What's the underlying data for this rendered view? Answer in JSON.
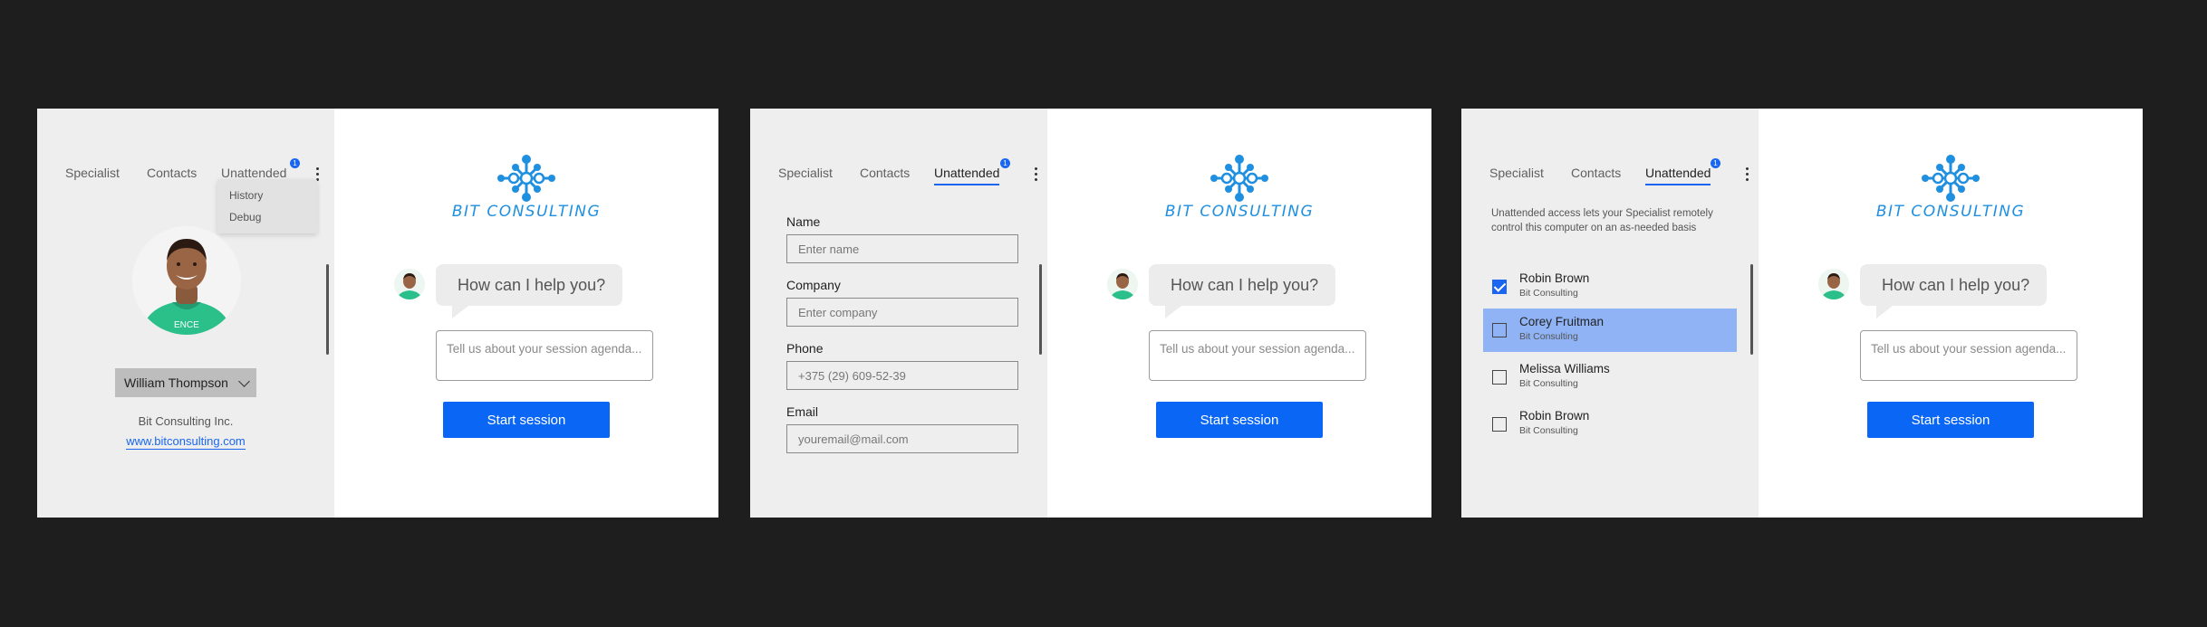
{
  "brand": {
    "accent": "#1a66f0",
    "logo_text": "BIT CONSULTING"
  },
  "tabs": {
    "specialist": "Specialist",
    "contacts": "Contacts",
    "unattended": "Unattended",
    "badge": "1"
  },
  "menu": {
    "items": [
      "History",
      "Debug"
    ]
  },
  "profile": {
    "name": "William Thompson",
    "company": "Bit Consulting Inc.",
    "website": "www.bitconsulting.com"
  },
  "contact_form": {
    "name_label": "Name",
    "name_placeholder": "Enter name",
    "company_label": "Company",
    "company_placeholder": "Enter company",
    "phone_label": "Phone",
    "phone_placeholder": "+375 (29) 609-52-39",
    "email_label": "Email",
    "email_placeholder": "youremail@mail.com"
  },
  "unattended": {
    "description": "Unattended access lets your Specialist remotely control this computer on an as-needed basis",
    "list": [
      {
        "name": "Robin Brown",
        "company": "Bit Consulting",
        "checked": true,
        "selected": false
      },
      {
        "name": "Corey Fruitman",
        "company": "Bit Consulting",
        "checked": false,
        "selected": true
      },
      {
        "name": "Melissa Williams",
        "company": "Bit Consulting",
        "checked": false,
        "selected": false
      },
      {
        "name": "Robin Brown",
        "company": "Bit Consulting",
        "checked": false,
        "selected": false
      }
    ]
  },
  "chat": {
    "greeting": "How can I help you?",
    "agenda_placeholder": "Tell us about your session agenda...",
    "start_label": "Start session"
  }
}
